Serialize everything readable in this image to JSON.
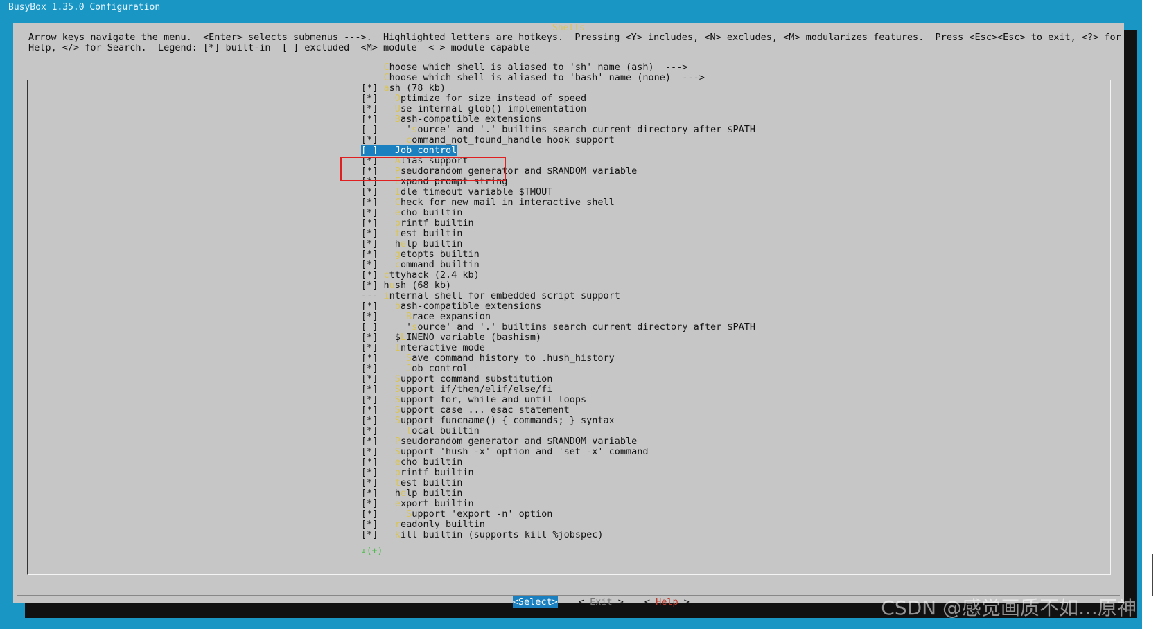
{
  "window": {
    "title": "BusyBox 1.35.0 Configuration"
  },
  "dialog": {
    "title": "Shells",
    "help_line_1": "Arrow keys navigate the menu.  <Enter> selects submenus --->.  Highlighted letters are hotkeys.  Pressing <Y> includes, <N> excludes, <M> modularizes features.  Press <Esc><Esc> to exit, <?> for",
    "help_line_2": "Help, </> for Search.  Legend: [*] built-in  [ ] excluded  <M> module  < > module capable"
  },
  "menu": {
    "items": [
      {
        "mark": "   ",
        "indent": "",
        "hotkey": "C",
        "text": "hoose which shell is aliased to 'sh' name (ash)  --->"
      },
      {
        "mark": "   ",
        "indent": "",
        "hotkey": "C",
        "text": "hoose which shell is aliased to 'bash' name (none)  --->"
      },
      {
        "mark": "[*]",
        "indent": "",
        "hotkey": "a",
        "text": "sh (78 kb)"
      },
      {
        "mark": "[*]",
        "indent": "  ",
        "hotkey": "O",
        "text": "ptimize for size instead of speed"
      },
      {
        "mark": "[*]",
        "indent": "  ",
        "hotkey": "U",
        "text": "se internal glob() implementation"
      },
      {
        "mark": "[*]",
        "indent": "  ",
        "hotkey": "B",
        "text": "ash-compatible extensions"
      },
      {
        "mark": "[ ]",
        "indent": "    '",
        "hotkey": "s",
        "text": "ource' and '.' builtins search current directory after $PATH"
      },
      {
        "mark": "[*]",
        "indent": "    ",
        "hotkey": "c",
        "text": "ommand_not_found_handle hook support"
      },
      {
        "mark": "[ ]",
        "indent": "  ",
        "hotkey": "J",
        "text": "ob control",
        "selected": true
      },
      {
        "mark": "[*]",
        "indent": "  ",
        "hotkey": "A",
        "text": "lias support"
      },
      {
        "mark": "[*]",
        "indent": "  ",
        "hotkey": "P",
        "text": "seudorandom generator and $RANDOM variable"
      },
      {
        "mark": "[*]",
        "indent": "  ",
        "hotkey": "E",
        "text": "xpand prompt string"
      },
      {
        "mark": "[*]",
        "indent": "  ",
        "hotkey": "I",
        "text": "dle timeout variable $TMOUT"
      },
      {
        "mark": "[*]",
        "indent": "  ",
        "hotkey": "C",
        "text": "heck for new mail in interactive shell"
      },
      {
        "mark": "[*]",
        "indent": "  ",
        "hotkey": "e",
        "text": "cho builtin"
      },
      {
        "mark": "[*]",
        "indent": "  ",
        "hotkey": "p",
        "text": "rintf builtin"
      },
      {
        "mark": "[*]",
        "indent": "  ",
        "hotkey": "t",
        "text": "est builtin"
      },
      {
        "mark": "[*]",
        "indent": "  h",
        "hotkey": "e",
        "text": "lp builtin"
      },
      {
        "mark": "[*]",
        "indent": "  ",
        "hotkey": "g",
        "text": "etopts builtin"
      },
      {
        "mark": "[*]",
        "indent": "  ",
        "hotkey": "c",
        "text": "ommand builtin"
      },
      {
        "mark": "[*]",
        "indent": "",
        "hotkey": "c",
        "text": "ttyhack (2.4 kb)"
      },
      {
        "mark": "[*]",
        "indent": "h",
        "hotkey": "u",
        "text": "sh (68 kb)"
      },
      {
        "mark": "---",
        "indent": "",
        "hotkey": "i",
        "text": "nternal shell for embedded script support"
      },
      {
        "mark": "[*]",
        "indent": "  ",
        "hotkey": "b",
        "text": "ash-compatible extensions"
      },
      {
        "mark": "[*]",
        "indent": "    ",
        "hotkey": "B",
        "text": "race expansion"
      },
      {
        "mark": "[ ]",
        "indent": "    '",
        "hotkey": "s",
        "text": "ource' and '.' builtins search current directory after $PATH"
      },
      {
        "mark": "[*]",
        "indent": "  $",
        "hotkey": "L",
        "text": "INENO variable (bashism)"
      },
      {
        "mark": "[*]",
        "indent": "  ",
        "hotkey": "I",
        "text": "nteractive mode"
      },
      {
        "mark": "[*]",
        "indent": "    ",
        "hotkey": "S",
        "text": "ave command history to .hush_history"
      },
      {
        "mark": "[*]",
        "indent": "    ",
        "hotkey": "J",
        "text": "ob control"
      },
      {
        "mark": "[*]",
        "indent": "  ",
        "hotkey": "S",
        "text": "upport command substitution"
      },
      {
        "mark": "[*]",
        "indent": "  ",
        "hotkey": "S",
        "text": "upport if/then/elif/else/fi"
      },
      {
        "mark": "[*]",
        "indent": "  ",
        "hotkey": "S",
        "text": "upport for, while and until loops"
      },
      {
        "mark": "[*]",
        "indent": "  ",
        "hotkey": "S",
        "text": "upport case ... esac statement"
      },
      {
        "mark": "[*]",
        "indent": "  ",
        "hotkey": "S",
        "text": "upport funcname() { commands; } syntax"
      },
      {
        "mark": "[*]",
        "indent": "    ",
        "hotkey": "l",
        "text": "ocal builtin"
      },
      {
        "mark": "[*]",
        "indent": "  ",
        "hotkey": "P",
        "text": "seudorandom generator and $RANDOM variable"
      },
      {
        "mark": "[*]",
        "indent": "  ",
        "hotkey": "S",
        "text": "upport 'hush -x' option and 'set -x' command"
      },
      {
        "mark": "[*]",
        "indent": "  ",
        "hotkey": "e",
        "text": "cho builtin"
      },
      {
        "mark": "[*]",
        "indent": "  ",
        "hotkey": "p",
        "text": "rintf builtin"
      },
      {
        "mark": "[*]",
        "indent": "  ",
        "hotkey": "t",
        "text": "est builtin"
      },
      {
        "mark": "[*]",
        "indent": "  h",
        "hotkey": "e",
        "text": "lp builtin"
      },
      {
        "mark": "[*]",
        "indent": "  ",
        "hotkey": "e",
        "text": "xport builtin"
      },
      {
        "mark": "[*]",
        "indent": "    ",
        "hotkey": "S",
        "text": "upport 'export -n' option"
      },
      {
        "mark": "[*]",
        "indent": "  ",
        "hotkey": "r",
        "text": "eadonly builtin"
      },
      {
        "mark": "[*]",
        "indent": "  ",
        "hotkey": "k",
        "text": "ill builtin (supports kill %jobspec)"
      }
    ],
    "more_indicator": "↓(+)"
  },
  "buttons": {
    "select": "<Select>",
    "exit_open": "< ",
    "exit_hotkey": "E",
    "exit_rest": "xit",
    "exit_close": " >",
    "help_open": "< ",
    "help_hotkey": "H",
    "help_rest": "elp",
    "help_close": " >"
  },
  "watermark": "CSDN @感觉画质不如…原神",
  "colors": {
    "terminal_bg": "#1a96c4",
    "dialog_bg": "#c6c6c6",
    "selection_bg": "#1a80c0",
    "hotkey": "#d9c45a",
    "annotation_red": "#e02020"
  }
}
